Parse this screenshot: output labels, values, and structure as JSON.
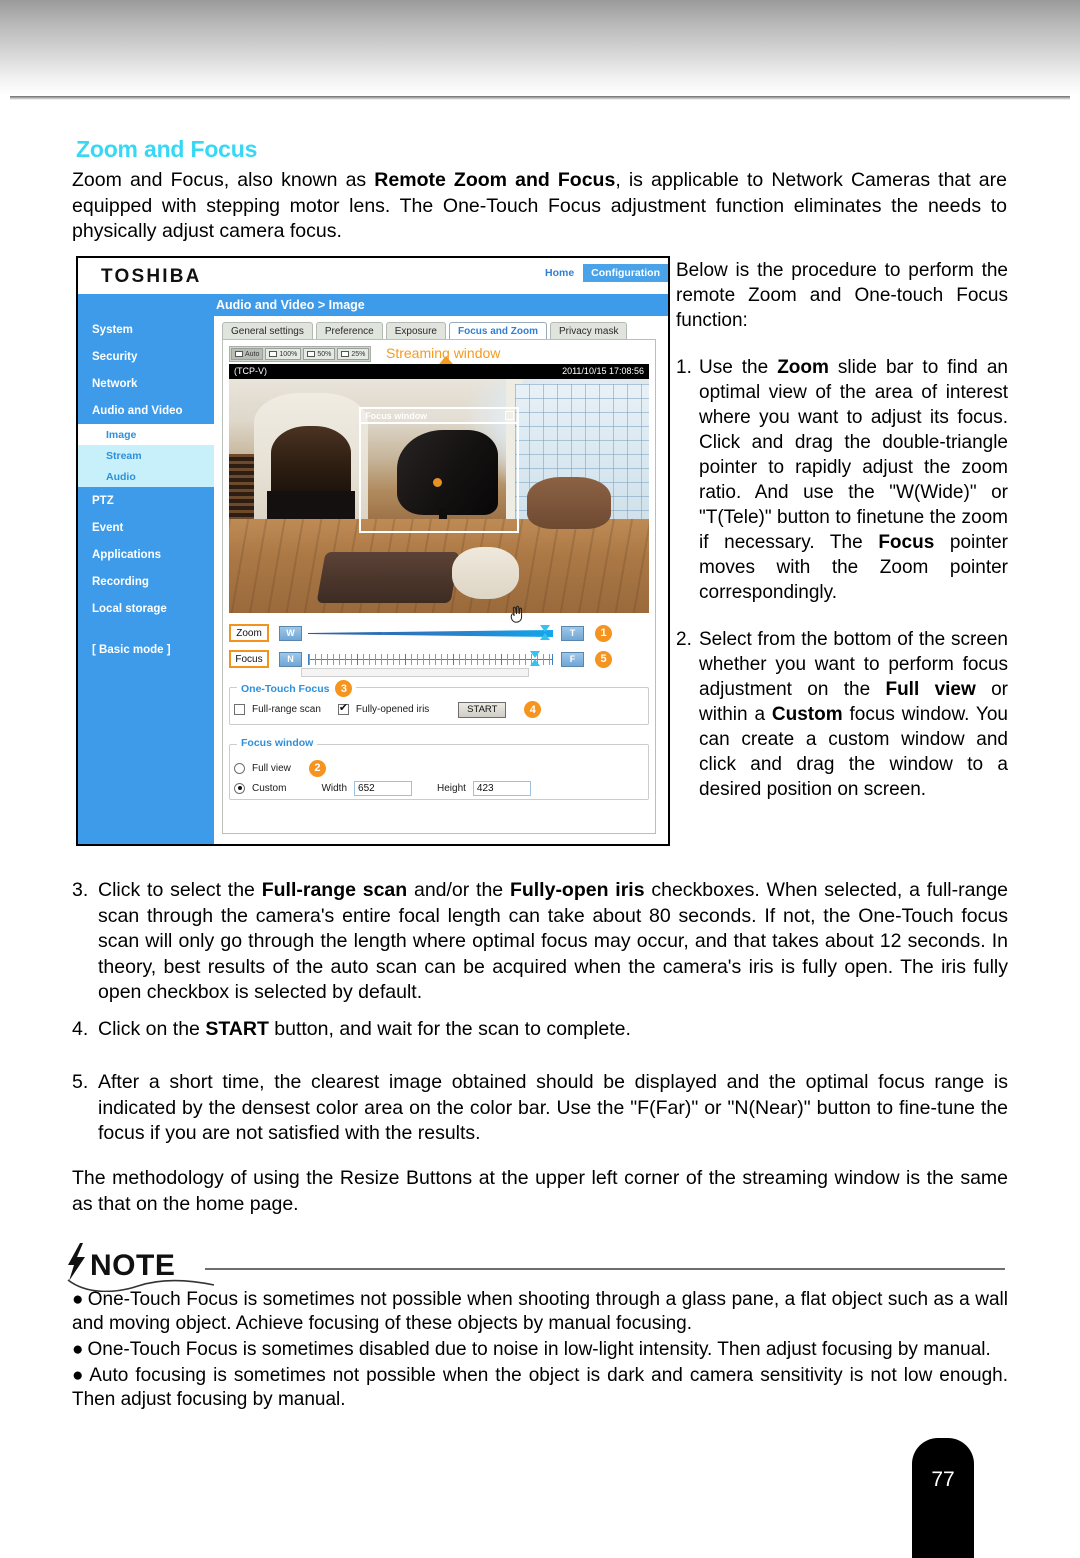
{
  "page": {
    "number": "77"
  },
  "section": {
    "title": "Zoom and Focus",
    "intro_pre": "Zoom and Focus, also known as ",
    "intro_bold": "Remote Zoom and Focus",
    "intro_post": ", is applicable to Network Cameras that are equipped with stepping motor lens. The One-Touch Focus adjustment function eliminates the needs to physically adjust camera focus."
  },
  "right_column": {
    "lead": "Below is the procedure to perform the remote Zoom and One-touch Focus function:",
    "steps": [
      {
        "number": "1.",
        "parts": [
          {
            "t": "Use the ",
            "b": false
          },
          {
            "t": "Zoom",
            "b": true
          },
          {
            "t": " slide bar to find an optimal view of the area of interest where you want to adjust its focus. Click and drag the double-triangle pointer to rapidly adjust the zoom ratio. And use the \"W(Wide)\" or \"T(Tele)\" button to finetune the zoom if necessary. The ",
            "b": false
          },
          {
            "t": "Focus",
            "b": true
          },
          {
            "t": " pointer moves with the Zoom pointer correspondingly.",
            "b": false
          }
        ]
      },
      {
        "number": "2.",
        "parts": [
          {
            "t": "Select from the bottom of the screen whether you want to perform focus adjustment on the ",
            "b": false
          },
          {
            "t": "Full view",
            "b": true
          },
          {
            "t": " or within a ",
            "b": false
          },
          {
            "t": "Custom",
            "b": true
          },
          {
            "t": " focus window. You can create a custom window and click and drag the window to a desired position on screen.",
            "b": false
          }
        ]
      }
    ]
  },
  "body_steps": [
    {
      "number": "3.",
      "parts": [
        {
          "t": "Click to select the ",
          "b": false
        },
        {
          "t": "Full-range scan",
          "b": true
        },
        {
          "t": " and/or the ",
          "b": false
        },
        {
          "t": "Fully-open iris",
          "b": true
        },
        {
          "t": " checkboxes. When selected, a full-range scan through the camera's entire focal length can take about 80 seconds. If not, the One-Touch focus scan will only go through the length where optimal focus may occur, and that takes about 12 seconds. In theory, best results of the auto scan can be acquired when the camera's iris is fully open. The iris fully open checkbox is selected by default.",
          "b": false
        }
      ]
    },
    {
      "number": "4.",
      "parts": [
        {
          "t": "Click on the ",
          "b": false
        },
        {
          "t": "START",
          "b": true
        },
        {
          "t": " button, and wait for the scan to complete.",
          "b": false
        }
      ]
    },
    {
      "number": "5.",
      "parts": [
        {
          "t": "After a short time, the clearest image obtained should be displayed and the optimal focus range is indicated by the densest color area on the color bar. Use the \"F(Far)\" or \"N(Near)\" button to fine-tune the focus if you are not satisfied with the results.",
          "b": false
        }
      ]
    }
  ],
  "closing_paragraph": "The methodology of using the Resize Buttons at the upper left corner of the streaming window is the same as that on the home page.",
  "note": {
    "heading": "NOTE",
    "bullet_char": "●",
    "items": [
      "One-Touch Focus is sometimes not possible when shooting through a glass pane, a flat object such as a wall and moving object. Achieve focusing of these objects by manual focusing.",
      "One-Touch Focus is sometimes disabled due to noise in low-light intensity. Then adjust focusing by manual.",
      "Auto focusing is sometimes not possible when the object is dark and camera sensitivity is not low enough. Then adjust focusing by manual."
    ]
  },
  "screenshot": {
    "brand": "TOSHIBA",
    "topnav": {
      "home": "Home",
      "configuration": "Configuration"
    },
    "breadcrumb": "Audio and Video  > Image",
    "sidebar": [
      {
        "label": "System",
        "type": "item"
      },
      {
        "label": "Security",
        "type": "item"
      },
      {
        "label": "Network",
        "type": "item"
      },
      {
        "label": "Audio and Video",
        "type": "item"
      },
      {
        "label": "Image",
        "type": "sub-active"
      },
      {
        "label": "Stream",
        "type": "sub-tint"
      },
      {
        "label": "Audio",
        "type": "sub-tint"
      },
      {
        "label": "PTZ",
        "type": "item"
      },
      {
        "label": "Event",
        "type": "item"
      },
      {
        "label": "Applications",
        "type": "item"
      },
      {
        "label": "Recording",
        "type": "item"
      },
      {
        "label": "Local storage",
        "type": "item"
      },
      {
        "label": "[ Basic mode ]",
        "type": "item"
      }
    ],
    "tabs": [
      {
        "label": "General settings",
        "active": false
      },
      {
        "label": "Preference",
        "active": false
      },
      {
        "label": "Exposure",
        "active": false
      },
      {
        "label": "Focus and Zoom",
        "active": true
      },
      {
        "label": "Privacy mask",
        "active": false
      }
    ],
    "resize_buttons": [
      {
        "label": "Auto",
        "active": true
      },
      {
        "label": "100%",
        "active": false
      },
      {
        "label": "50%",
        "active": false
      },
      {
        "label": "25%",
        "active": false
      }
    ],
    "streaming_window_label": "Streaming window",
    "video": {
      "protocol": "(TCP-V)",
      "timestamp": "2011/10/15  17:08:56",
      "focus_window_label": "Focus window"
    },
    "zoom_row": {
      "tag": "Zoom",
      "wide_button": "W",
      "tele_button": "T",
      "badge": "1"
    },
    "focus_row": {
      "tag": "Focus",
      "near_button": "N",
      "far_button": "F",
      "badge": "5"
    },
    "one_touch_focus": {
      "legend": "One-Touch Focus",
      "badge": "3",
      "full_range_scan_label": "Full-range scan",
      "full_range_scan_checked": false,
      "fully_opened_iris_label": "Fully-opened iris",
      "fully_opened_iris_checked": true,
      "start_button": "START",
      "start_badge": "4"
    },
    "focus_window_panel": {
      "legend": "Focus window",
      "full_view_label": "Full view",
      "full_view_selected": false,
      "badge": "2",
      "custom_label": "Custom",
      "custom_selected": true,
      "width_label": "Width",
      "width_value": "652",
      "height_label": "Height",
      "height_value": "423"
    }
  },
  "colors": {
    "heading_cyan": "#37d8f5",
    "ui_blue": "#3d9bea",
    "accent_orange": "#f5941f",
    "tab_active_text": "#2f7fd6"
  }
}
